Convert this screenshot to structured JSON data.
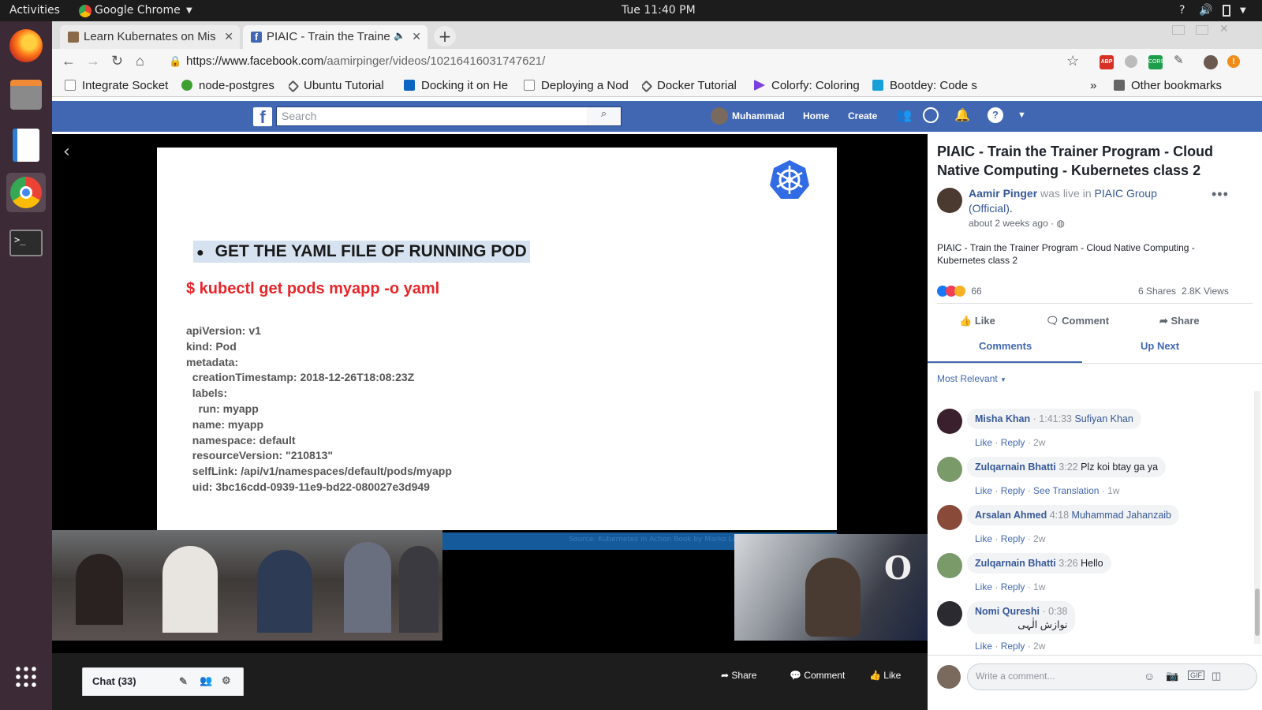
{
  "os": {
    "activities": "Activities",
    "app_name": "Google Chrome",
    "clock": "Tue 11:40 PM",
    "tray_help": "?"
  },
  "tabs": [
    {
      "title": "Learn Kubernates on Mis",
      "active": false
    },
    {
      "title": "PIAIC - Train the Traine",
      "active": true
    }
  ],
  "address": {
    "url_prefix": "https://www.facebook.com",
    "url_path": "/aamirpinger/videos/10216416031747621/"
  },
  "bookmarks": [
    {
      "label": "Integrate Socket",
      "icon_color": "#888888"
    },
    {
      "label": "node-postgres",
      "icon_color": "#3f9f33"
    },
    {
      "label": "Ubuntu Tutorial",
      "icon_color": "#555555"
    },
    {
      "label": "Docking it on He",
      "icon_color": "#0a66c2"
    },
    {
      "label": "Deploying a Nod",
      "icon_color": "#888888"
    },
    {
      "label": "Docker Tutorial",
      "icon_color": "#555555"
    },
    {
      "label": "Colorfy: Coloring",
      "icon_color": "#7c3fe0"
    },
    {
      "label": "Bootdey: Code s",
      "icon_color": "#1aa0d8"
    }
  ],
  "bookmarks_overflow": "»",
  "other_bookmarks": "Other bookmarks",
  "facebook": {
    "brand_color": "#4267b2",
    "logo": "f",
    "search_placeholder": "Search",
    "user_name": "Muhammad",
    "home": "Home",
    "create": "Create"
  },
  "slide": {
    "bullet": "●",
    "title": "GET THE YAML FILE OF RUNNING POD",
    "command": "$ kubectl get pods myapp -o yaml",
    "yaml": "apiVersion: v1\nkind: Pod\nmetadata:\n  creationTimestamp: 2018-12-26T18:08:23Z\n  labels:\n    run: myapp\n  name: myapp\n  namespace: default\n  resourceVersion: \"210813\"\n  selfLink: /api/v1/namespaces/default/pods/myapp\n  uid: 3bc16cdd-0939-11e9-bd22-080027e3d949",
    "source": "Source: Kubernetes in Action Book by Marko Luksa (Manning Publications)"
  },
  "video_bar": {
    "share": "Share",
    "comment": "Comment",
    "like": "Like",
    "chat": "Chat (33)"
  },
  "post": {
    "title": "PIAIC - Train the Trainer Program - Cloud Native Computing - Kubernetes class 2",
    "author": "Aamir Pinger",
    "was_live_in": "was live in",
    "group": "PIAIC Group (Official)",
    "period": ".",
    "time": "about 2 weeks ago ·",
    "description": "PIAIC - Train the Trainer Program - Cloud Native Computing - Kubernetes class 2",
    "reactions_count": "66",
    "shares": "6 Shares",
    "views": "2.8K Views",
    "like": "Like",
    "comment": "Comment",
    "share": "Share",
    "tab_comments": "Comments",
    "tab_upnext": "Up Next",
    "sort": "Most Relevant",
    "composer_placeholder": "Write a comment..."
  },
  "comments": [
    {
      "name": "Misha Khan",
      "time": "· 1:41:33",
      "text": "Sufiyan Khan",
      "text_is_link": true,
      "meta": [
        "Like",
        "Reply",
        "2w"
      ],
      "avatar_color": "#3a1f2c"
    },
    {
      "name": "Zulqarnain Bhatti",
      "time": "3:22",
      "text": "Plz koi btay ga ya",
      "text_is_link": false,
      "meta": [
        "Like",
        "Reply",
        "See Translation",
        "1w"
      ],
      "avatar_color": "#7a9a6a"
    },
    {
      "name": "Arsalan Ahmed",
      "time": "4:18",
      "text": "Muhammad Jahanzaib",
      "text_is_link": true,
      "meta": [
        "Like",
        "Reply",
        "2w"
      ],
      "avatar_color": "#8a4a3a"
    },
    {
      "name": "Zulqarnain Bhatti",
      "time": "3:26",
      "text": "Hello",
      "text_is_link": false,
      "meta": [
        "Like",
        "Reply",
        "1w"
      ],
      "avatar_color": "#7a9a6a"
    },
    {
      "name": "Nomi Qureshi",
      "time": "· 0:38",
      "text": "نوازش الٰہی",
      "text_is_link": false,
      "meta": [
        "Like",
        "Reply",
        "2w"
      ],
      "avatar_color": "#2a2a30"
    }
  ]
}
